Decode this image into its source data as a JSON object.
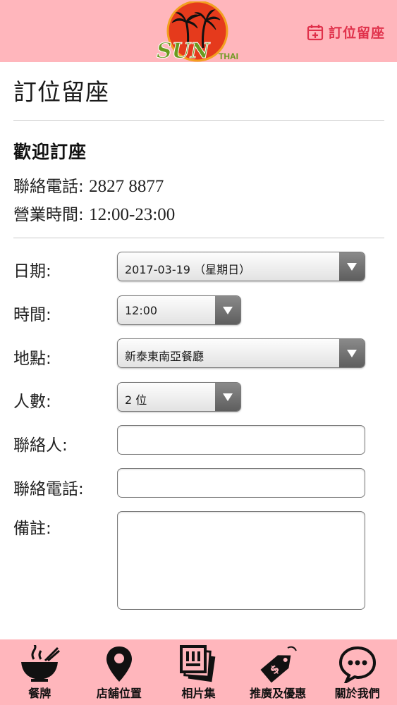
{
  "header": {
    "logo_text_main": "SUN",
    "logo_text_sub": "THAI",
    "reserve_link_label": "訂位留座"
  },
  "page": {
    "title": "訂位留座",
    "welcome": "歡迎訂座",
    "phone_label": "聯絡電話:",
    "phone_value": "2827 8877",
    "hours_label": "營業時間:",
    "hours_value": "12:00-23:00"
  },
  "form": {
    "date_label": "日期:",
    "date_value": "2017-03-19 （星期日）",
    "time_label": "時間:",
    "time_value": "12:00",
    "location_label": "地點:",
    "location_value": "新泰東南亞餐廳",
    "people_label": "人數:",
    "people_value": "2 位",
    "contact_label": "聯絡人:",
    "contact_value": "",
    "contact_phone_label": "聯絡電話:",
    "contact_phone_value": "",
    "remarks_label": "備註:",
    "remarks_value": ""
  },
  "bottom_nav": {
    "items": [
      {
        "label": "餐牌",
        "icon": "bowl-icon"
      },
      {
        "label": "店舖位置",
        "icon": "map-pin-icon"
      },
      {
        "label": "相片集",
        "icon": "photos-icon"
      },
      {
        "label": "推廣及優惠",
        "icon": "price-tag-icon"
      },
      {
        "label": "關於我們",
        "icon": "chat-bubble-icon"
      }
    ]
  },
  "colors": {
    "header_bg": "#ffb6bc",
    "accent": "#e0314b",
    "logo_sun": "#e53a1c",
    "logo_text": "#6a9a1e"
  }
}
